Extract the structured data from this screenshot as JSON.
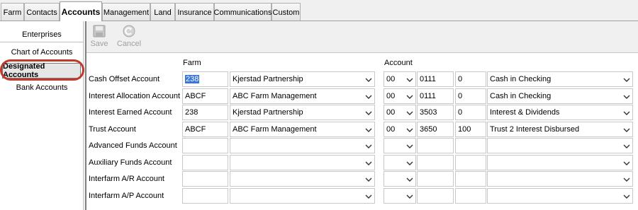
{
  "tabs": [
    "Farm",
    "Contacts",
    "Accounts",
    "Management",
    "Land",
    "Insurance",
    "Communications",
    "Custom"
  ],
  "active_tab": "Accounts",
  "sidebar": {
    "items": [
      "Enterprises",
      "Chart of Accounts",
      "Designated Accounts",
      "Bank Accounts"
    ],
    "selected": "Designated Accounts"
  },
  "toolbar": {
    "save_label": "Save",
    "cancel_label": "Cancel"
  },
  "columns": {
    "farm": "Farm",
    "account": "Account"
  },
  "rows": [
    {
      "label": "Cash Offset Account",
      "farm_code": "238",
      "farm_name": "Kjerstad Partnership",
      "acct_a": "00",
      "acct_b": "0111",
      "acct_c": "0",
      "acct_name": "Cash in Checking"
    },
    {
      "label": "Interest Allocation Account",
      "farm_code": "ABCF",
      "farm_name": "ABC Farm Management",
      "acct_a": "00",
      "acct_b": "0111",
      "acct_c": "0",
      "acct_name": "Cash in Checking"
    },
    {
      "label": "Interest Earned Account",
      "farm_code": "238",
      "farm_name": "Kjerstad Partnership",
      "acct_a": "00",
      "acct_b": "3503",
      "acct_c": "0",
      "acct_name": "Interest & Dividends"
    },
    {
      "label": "Trust Account",
      "farm_code": "ABCF",
      "farm_name": "ABC Farm Management",
      "acct_a": "00",
      "acct_b": "3650",
      "acct_c": "100",
      "acct_name": "Trust 2 Interest Disbursed"
    },
    {
      "label": "Advanced Funds Account",
      "farm_code": "",
      "farm_name": "",
      "acct_a": "",
      "acct_b": "",
      "acct_c": "",
      "acct_name": ""
    },
    {
      "label": "Auxiliary Funds Account",
      "farm_code": "",
      "farm_name": "",
      "acct_a": "",
      "acct_b": "",
      "acct_c": "",
      "acct_name": ""
    },
    {
      "label": "Interfarm A/R Account",
      "farm_code": "",
      "farm_name": "",
      "acct_a": "",
      "acct_b": "",
      "acct_c": "",
      "acct_name": ""
    },
    {
      "label": "Interfarm A/P Account",
      "farm_code": "",
      "farm_name": "",
      "acct_a": "",
      "acct_b": "",
      "acct_c": "",
      "acct_name": ""
    }
  ],
  "colors": {
    "selection": "#3875d7",
    "highlight_ring": "#c0392b"
  }
}
